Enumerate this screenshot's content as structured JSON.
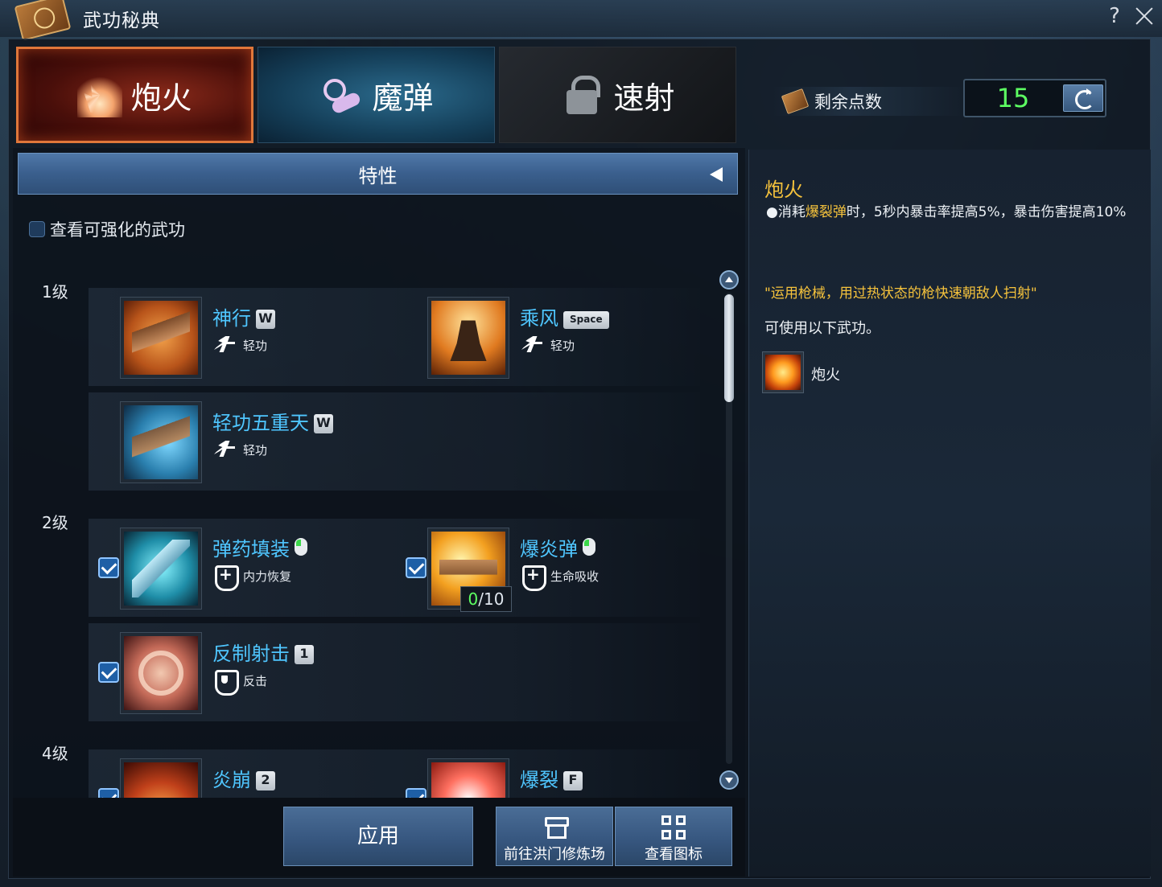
{
  "window": {
    "title": "武功秘典",
    "help_label": "?",
    "close_icon": "close-icon"
  },
  "tabs": [
    {
      "label": "炮火",
      "icon": "fire-burst-icon",
      "selected": true
    },
    {
      "label": "魔弹",
      "icon": "magic-scroll-icon",
      "selected": false
    },
    {
      "label": "速射",
      "icon": "lock-icon",
      "selected": false,
      "locked": true
    }
  ],
  "points": {
    "label": "剩余点数",
    "value": "15",
    "reset_icon": "reset-icon"
  },
  "trait_bar": {
    "label": "特性",
    "arrow_icon": "triangle-left-icon"
  },
  "filter": {
    "label": "查看可强化的武功",
    "checked": false
  },
  "levels": [
    {
      "label": "1级"
    },
    {
      "label": "2级"
    },
    {
      "label": "4级"
    }
  ],
  "skills": [
    {
      "name": "神行",
      "key": "W",
      "type": "轻功",
      "type_icon": "dash-icon"
    },
    {
      "name": "乘风",
      "key": "Space",
      "type": "轻功",
      "type_icon": "dash-icon"
    },
    {
      "name": "轻功五重天",
      "key": "W",
      "type": "轻功",
      "type_icon": "dash-icon"
    },
    {
      "name": "弹药填装",
      "key_icon": "mouse-icon",
      "type": "内力恢复",
      "type_icon": "heal-icon",
      "checked": true
    },
    {
      "name": "爆炎弹",
      "key_icon": "mouse-icon",
      "type": "生命吸收",
      "type_icon": "heal-icon",
      "checked": true,
      "progress_current": "0",
      "progress_total": "/10"
    },
    {
      "name": "反制射击",
      "key": "1",
      "type": "反击",
      "type_icon": "guard-icon",
      "checked": true
    },
    {
      "name": "炎崩",
      "key": "2",
      "checked": true
    },
    {
      "name": "爆裂",
      "key": "F",
      "checked": true
    }
  ],
  "detail": {
    "title": "炮火",
    "desc_prefix": "●消耗",
    "desc_highlight": "爆裂弹",
    "desc_suffix": "时，5秒内暴击率提高5%，暴击伤害提高10%",
    "quote": "\"运用枪械，用过热状态的枪快速朝敌人扫射\"",
    "usable_label": "可使用以下武功。",
    "usable_skill": "炮火"
  },
  "buttons": {
    "apply": "应用",
    "train": "前往洪门修炼场",
    "view_icons": "查看图标"
  },
  "colors": {
    "accent_blue": "#4fc6ff",
    "highlight_gold": "#f5c23c",
    "points_green": "#5dff62",
    "selected_tab_border": "#e0773a"
  }
}
